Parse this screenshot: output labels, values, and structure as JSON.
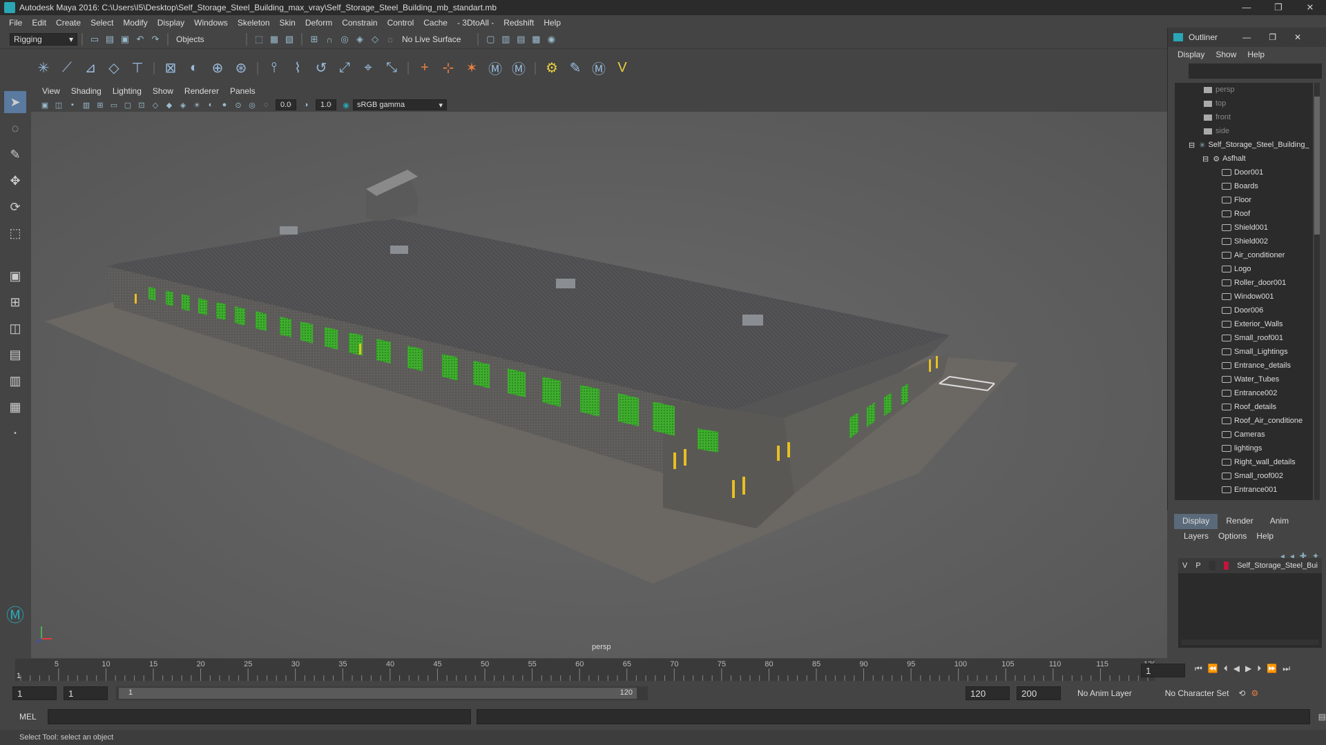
{
  "window": {
    "title": "Autodesk Maya 2016: C:\\Users\\I5\\Desktop\\Self_Storage_Steel_Building_max_vray\\Self_Storage_Steel_Building_mb_standart.mb"
  },
  "menu": [
    "File",
    "Edit",
    "Create",
    "Select",
    "Modify",
    "Display",
    "Windows",
    "Skeleton",
    "Skin",
    "Deform",
    "Constrain",
    "Control",
    "Cache",
    "- 3DtoAll -",
    "Redshift",
    "Help"
  ],
  "status": {
    "mode": "Rigging",
    "objects": "Objects",
    "live_surface": "No Live Surface"
  },
  "panel_menu": [
    "View",
    "Shading",
    "Lighting",
    "Show",
    "Renderer",
    "Panels"
  ],
  "panel_tools": {
    "exposure": "0.00",
    "gamma": "1.00",
    "color_space": "sRGB gamma"
  },
  "viewport": {
    "camera_label": "persp"
  },
  "timeline": {
    "ticks": [
      "5",
      "10",
      "15",
      "20",
      "25",
      "30",
      "35",
      "40",
      "45",
      "50",
      "55",
      "60",
      "65",
      "70",
      "75",
      "80",
      "85",
      "90",
      "95",
      "100",
      "105",
      "110",
      "115",
      "120"
    ],
    "current_start": "1",
    "current_frame": "1"
  },
  "range": {
    "start": "1",
    "start2": "1",
    "slider_start": "1",
    "slider_end": "120",
    "end": "120",
    "max_end": "200",
    "anim_layer": "No Anim Layer",
    "character_set": "No Character Set"
  },
  "command": {
    "lang": "MEL"
  },
  "help": {
    "text": "Select Tool: select an object"
  },
  "outliner": {
    "title": "Outliner",
    "menu": [
      "Display",
      "Show",
      "Help"
    ],
    "cameras": [
      "persp",
      "top",
      "front",
      "side"
    ],
    "root": "Self_Storage_Steel_Building_",
    "group": "Asfhalt",
    "items": [
      "Door001",
      "Boards",
      "Floor",
      "Roof",
      "Shield001",
      "Shield002",
      "Air_conditioner",
      "Logo",
      "Roller_door001",
      "Window001",
      "Door006",
      "Exterior_Walls",
      "Small_roof001",
      "Small_Lightings",
      "Entrance_details",
      "Water_Tubes",
      "Entrance002",
      "Roof_details",
      "Roof_Air_conditione",
      "Cameras",
      "lightings",
      "Right_wall_details",
      "Small_roof002",
      "Entrance001"
    ]
  },
  "layer_editor": {
    "tabs": [
      "Display",
      "Render",
      "Anim"
    ],
    "menu": [
      "Layers",
      "Options",
      "Help"
    ],
    "layer": {
      "v": "V",
      "p": "P",
      "name": "Self_Storage_Steel_Bui",
      "color": "#c0163c"
    }
  }
}
